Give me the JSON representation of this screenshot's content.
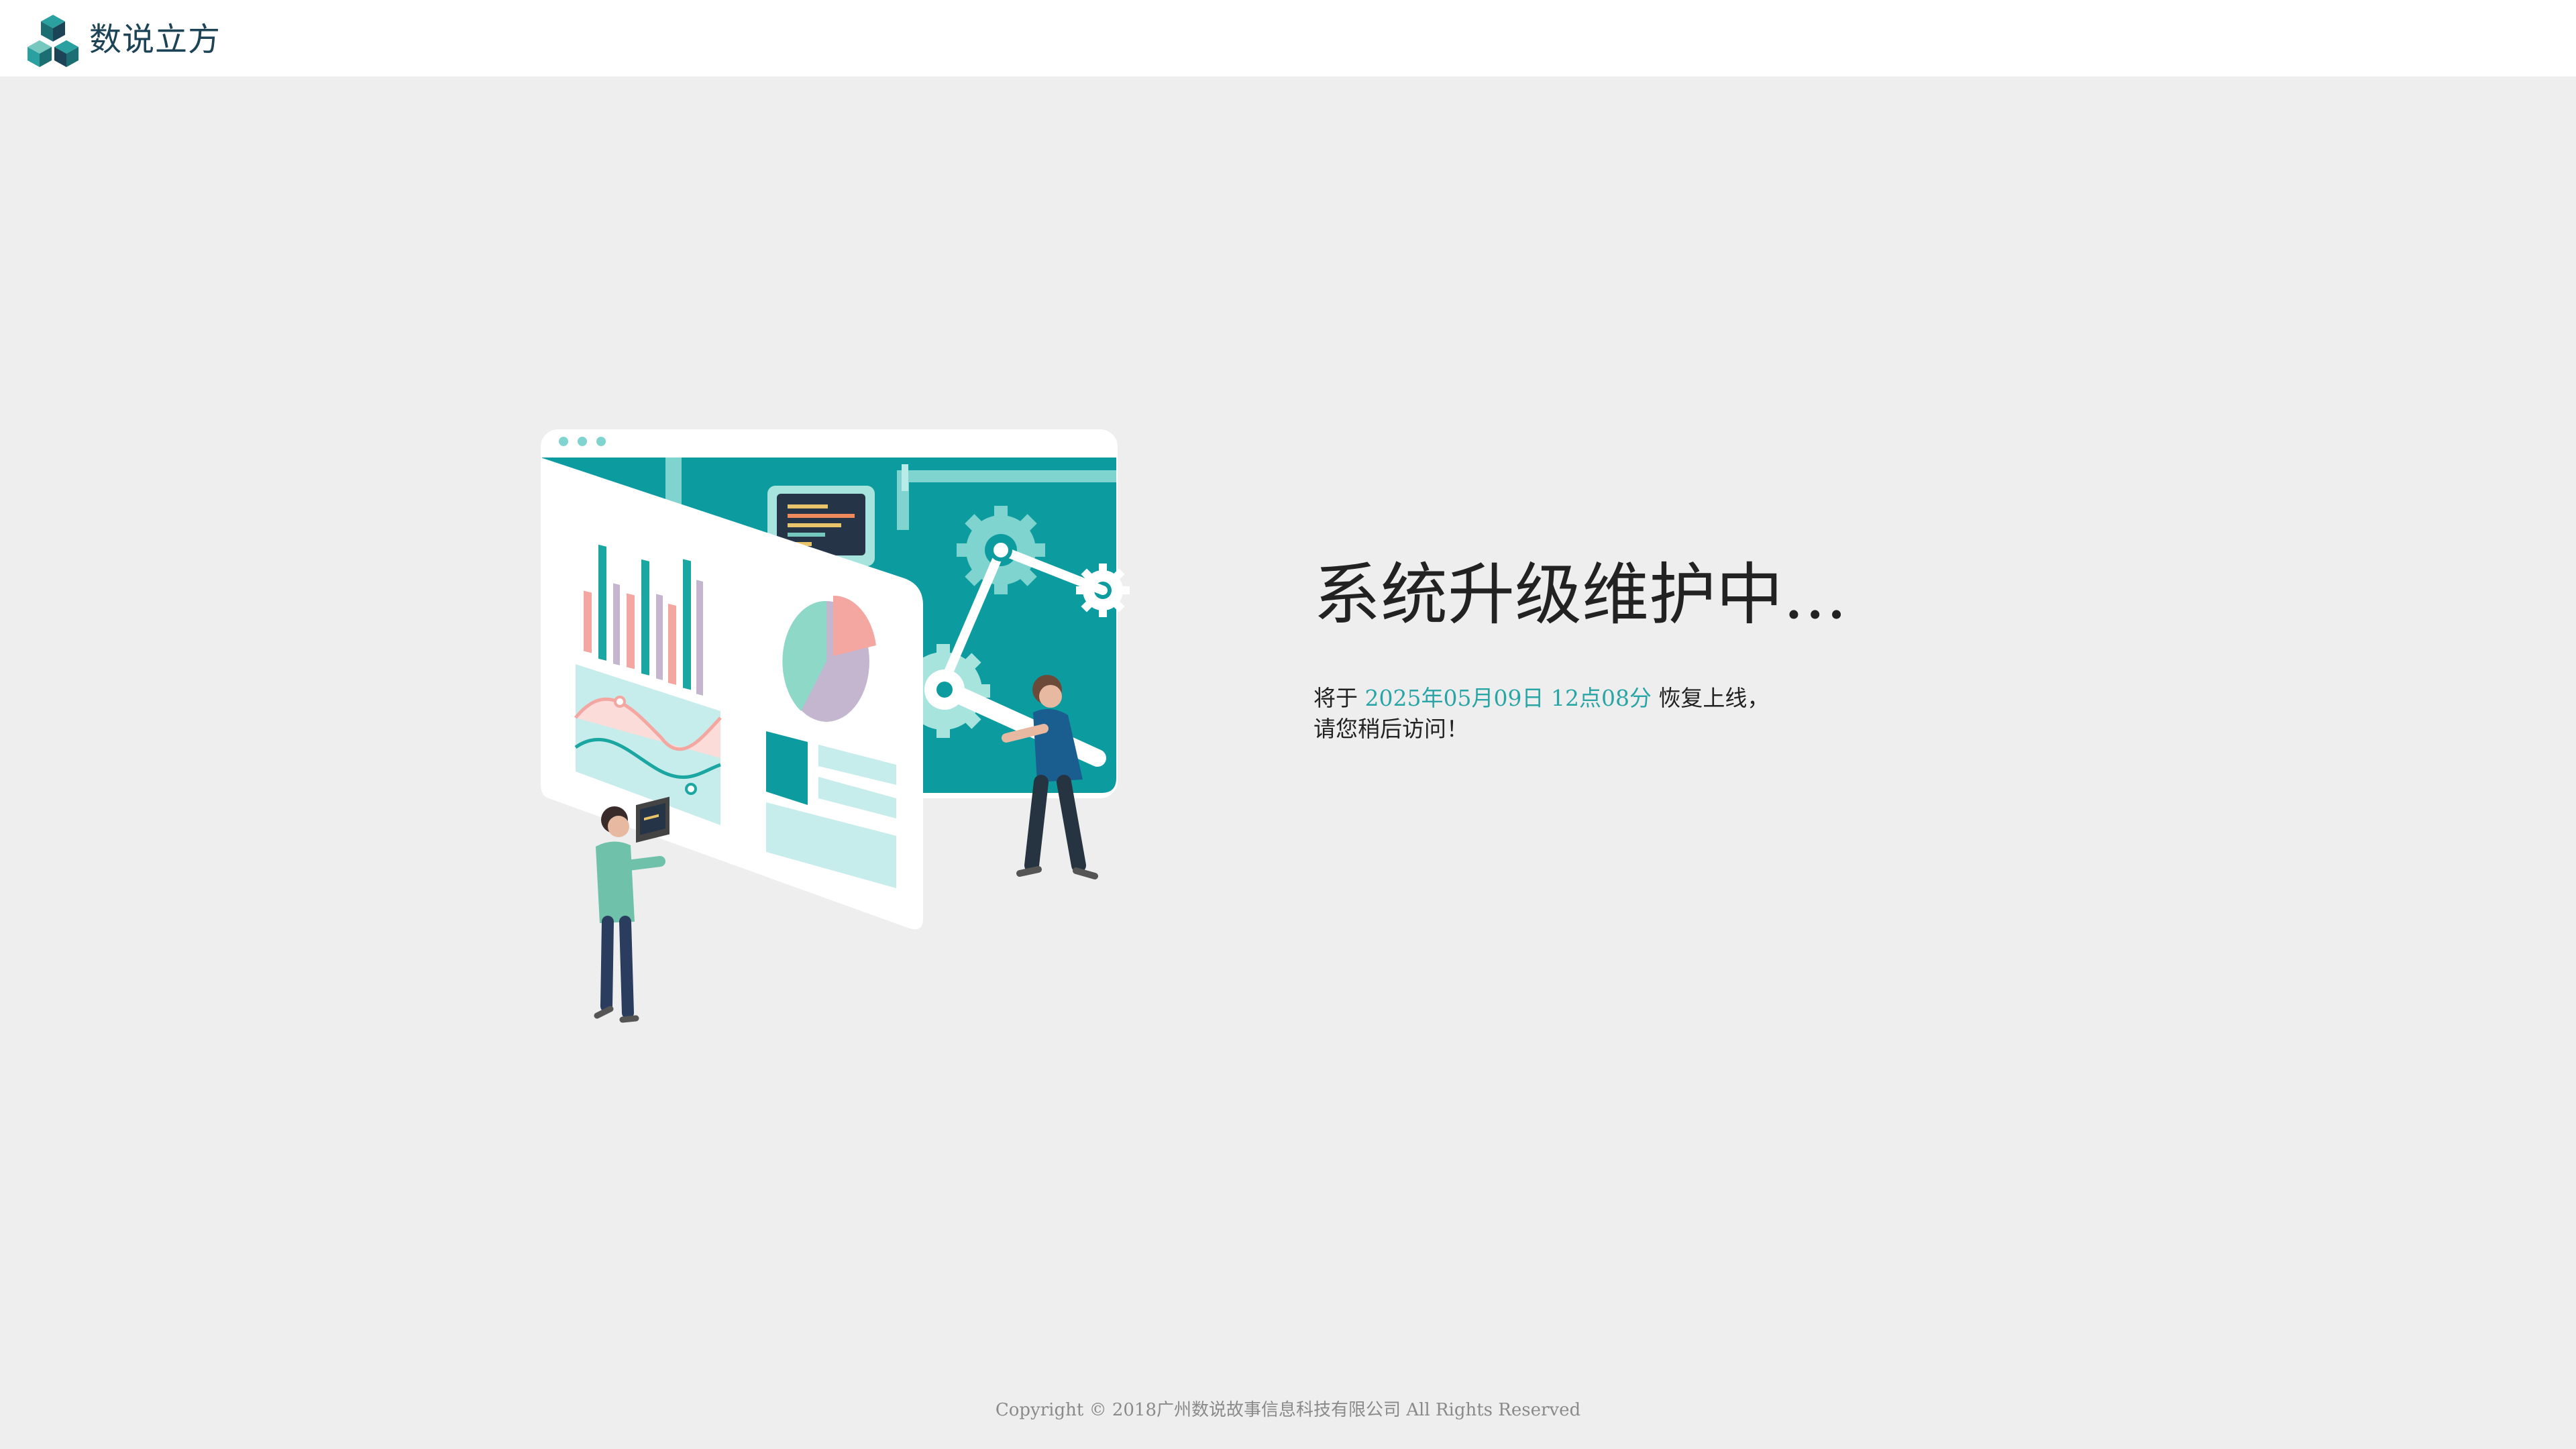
{
  "header": {
    "brand_name": "数说立方",
    "logo_icon": "cube-logo-icon"
  },
  "main": {
    "title": "系统升级维护中...",
    "notice_prefix": "将于 ",
    "notice_time": "2025年05月09日 12点08分",
    "notice_suffix": " 恢复上线，",
    "notice_line2": "请您稍后访问！"
  },
  "footer": {
    "copyright": "Copyright © 2018广州数说故事信息科技有限公司 All Rights Reserved"
  },
  "colors": {
    "accent": "#2aa5a5",
    "teal_dark": "#0c9ca0",
    "brand_text": "#1d4356",
    "background": "#eeeeee"
  }
}
